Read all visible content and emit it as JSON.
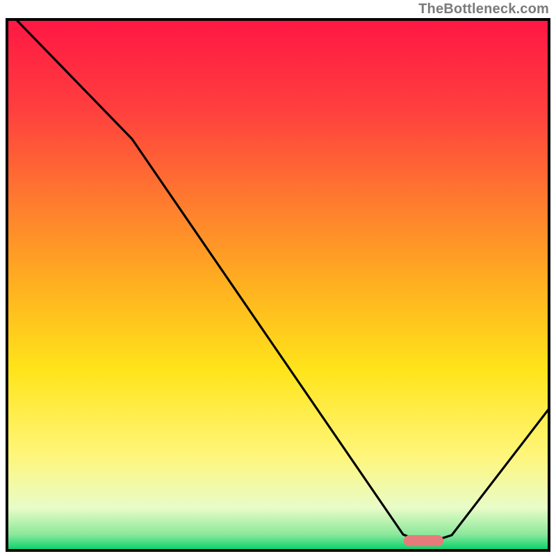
{
  "watermark": "TheBottleneck.com",
  "chart_data": {
    "type": "line",
    "title": "",
    "xlabel": "",
    "ylabel": "",
    "xlim": [
      0,
      100
    ],
    "ylim": [
      0,
      100
    ],
    "series": [
      {
        "name": "bottleneck-curve",
        "x": [
          2,
          23,
          73,
          78,
          82,
          100
        ],
        "y": [
          99,
          77,
          3,
          2,
          3,
          27
        ]
      }
    ],
    "optimum_marker": {
      "x_start": 73.2,
      "x_end": 80.5,
      "y": 2.2
    },
    "background_gradient": {
      "stops": [
        {
          "pct": 0.0,
          "color": "#ff1744"
        },
        {
          "pct": 0.17,
          "color": "#ff3f3e"
        },
        {
          "pct": 0.34,
          "color": "#ff7a2f"
        },
        {
          "pct": 0.5,
          "color": "#ffb020"
        },
        {
          "pct": 0.66,
          "color": "#ffe41a"
        },
        {
          "pct": 0.82,
          "color": "#fff67a"
        },
        {
          "pct": 0.92,
          "color": "#e8fcc8"
        },
        {
          "pct": 0.97,
          "color": "#8be89b"
        },
        {
          "pct": 1.0,
          "color": "#00d06a"
        }
      ]
    },
    "frame_color": "#000000",
    "curve_color": "#000000",
    "marker_color": "#e77a7a"
  }
}
